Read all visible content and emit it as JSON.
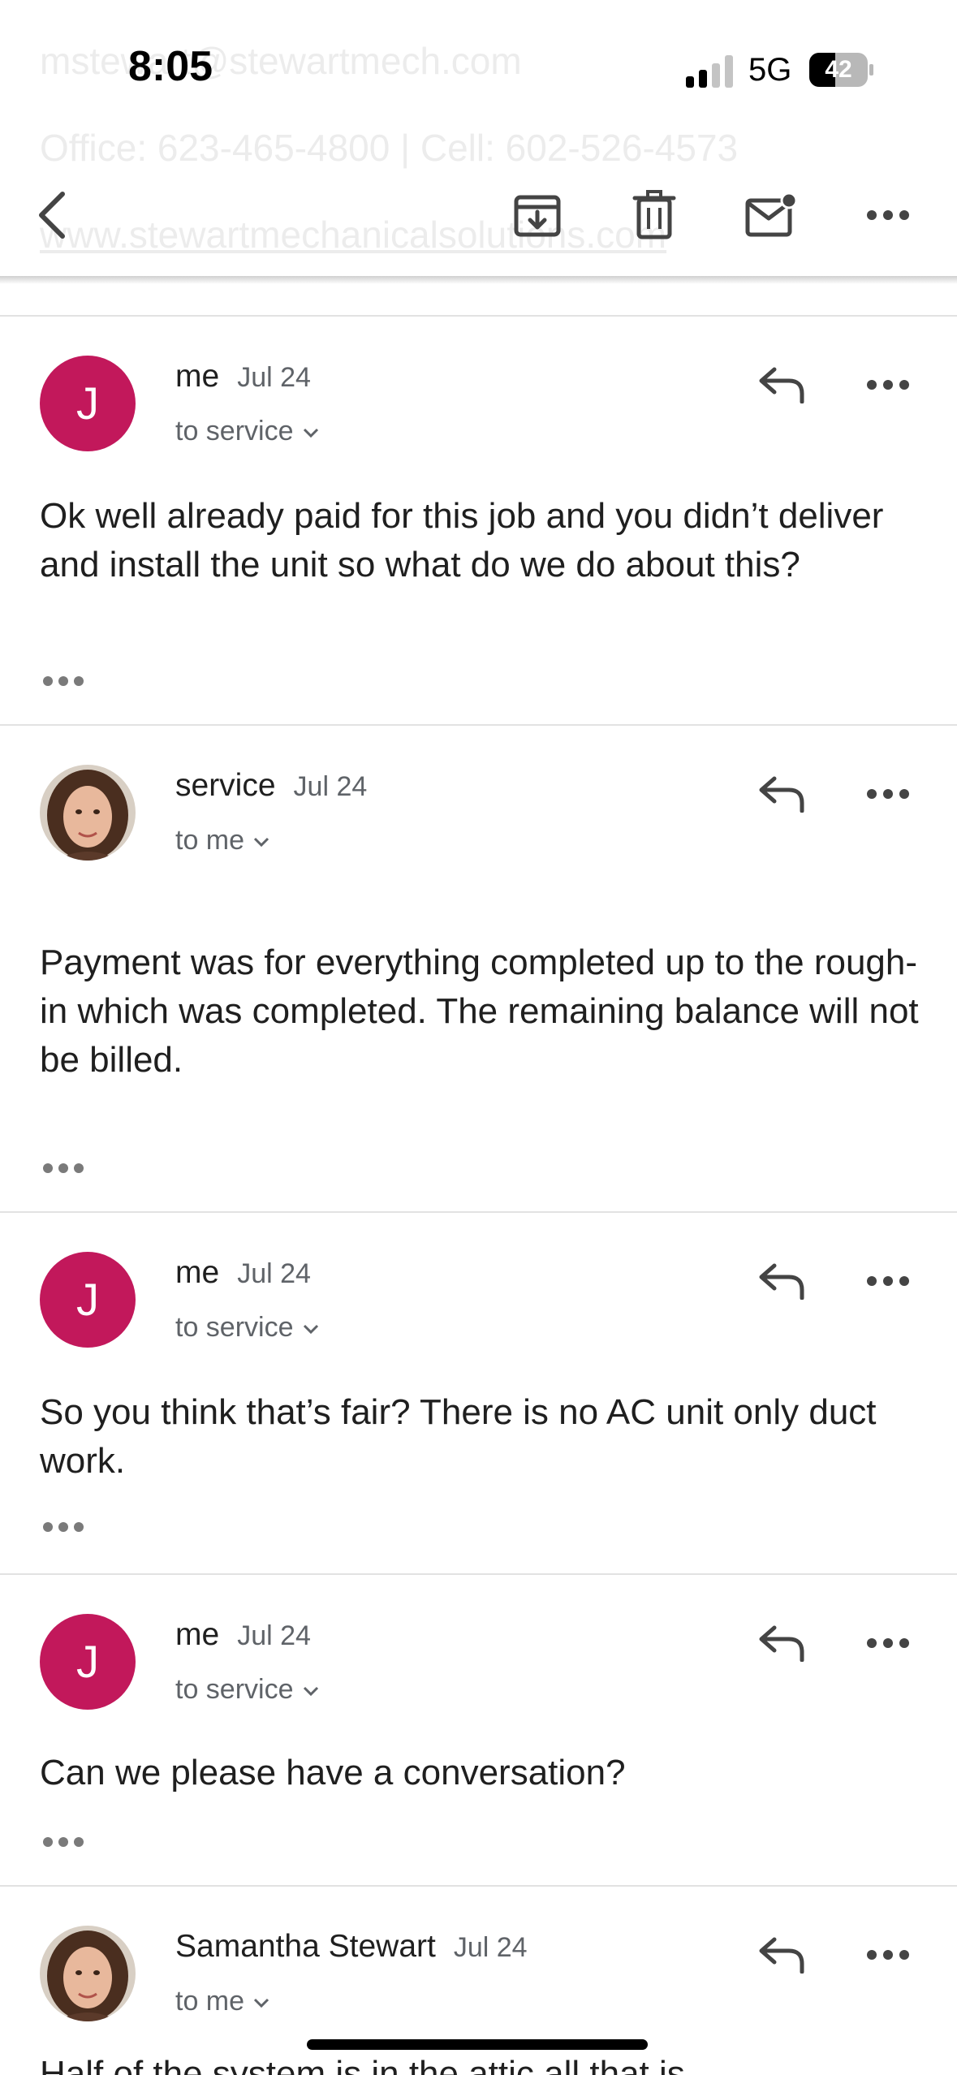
{
  "status_bar": {
    "time": "8:05",
    "network": "5G",
    "battery": "42"
  },
  "background_text": {
    "email": "mstewart@stewartmech.com",
    "phones": "Office: 623-465-4800 | Cell: 602-526-4573",
    "website": "www.stewartmechanicalsolutions.com"
  },
  "toolbar": {
    "icons": [
      "back-icon",
      "archive-icon",
      "trash-icon",
      "mark-unread-icon",
      "more-icon"
    ]
  },
  "messages": [
    {
      "avatar_letter": "J",
      "sender": "me",
      "date": "Jul 24",
      "recipient": "to service",
      "body": "Ok well already paid for this job and you didn’t deliver and install the unit so what do we do about this?"
    },
    {
      "avatar_letter": "",
      "sender": "service",
      "date": "Jul 24",
      "recipient": "to me",
      "body": "Payment was for everything completed up to the rough-in which was completed. The remaining balance will not be billed."
    },
    {
      "avatar_letter": "J",
      "sender": "me",
      "date": "Jul 24",
      "recipient": "to service",
      "body": "So you think that’s fair? There is no AC unit only duct work."
    },
    {
      "avatar_letter": "J",
      "sender": "me",
      "date": "Jul 24",
      "recipient": "to service",
      "body": "Can we please have a conversation?"
    },
    {
      "avatar_letter": "",
      "sender": "Samantha Stewart",
      "date": "Jul 24",
      "recipient": "to me",
      "body": "Half of the system is in the attic all that is"
    }
  ],
  "colors": {
    "avatar_bg": "#c2185b",
    "secondary_text": "#5f6368",
    "divider": "#e2e2e2"
  }
}
